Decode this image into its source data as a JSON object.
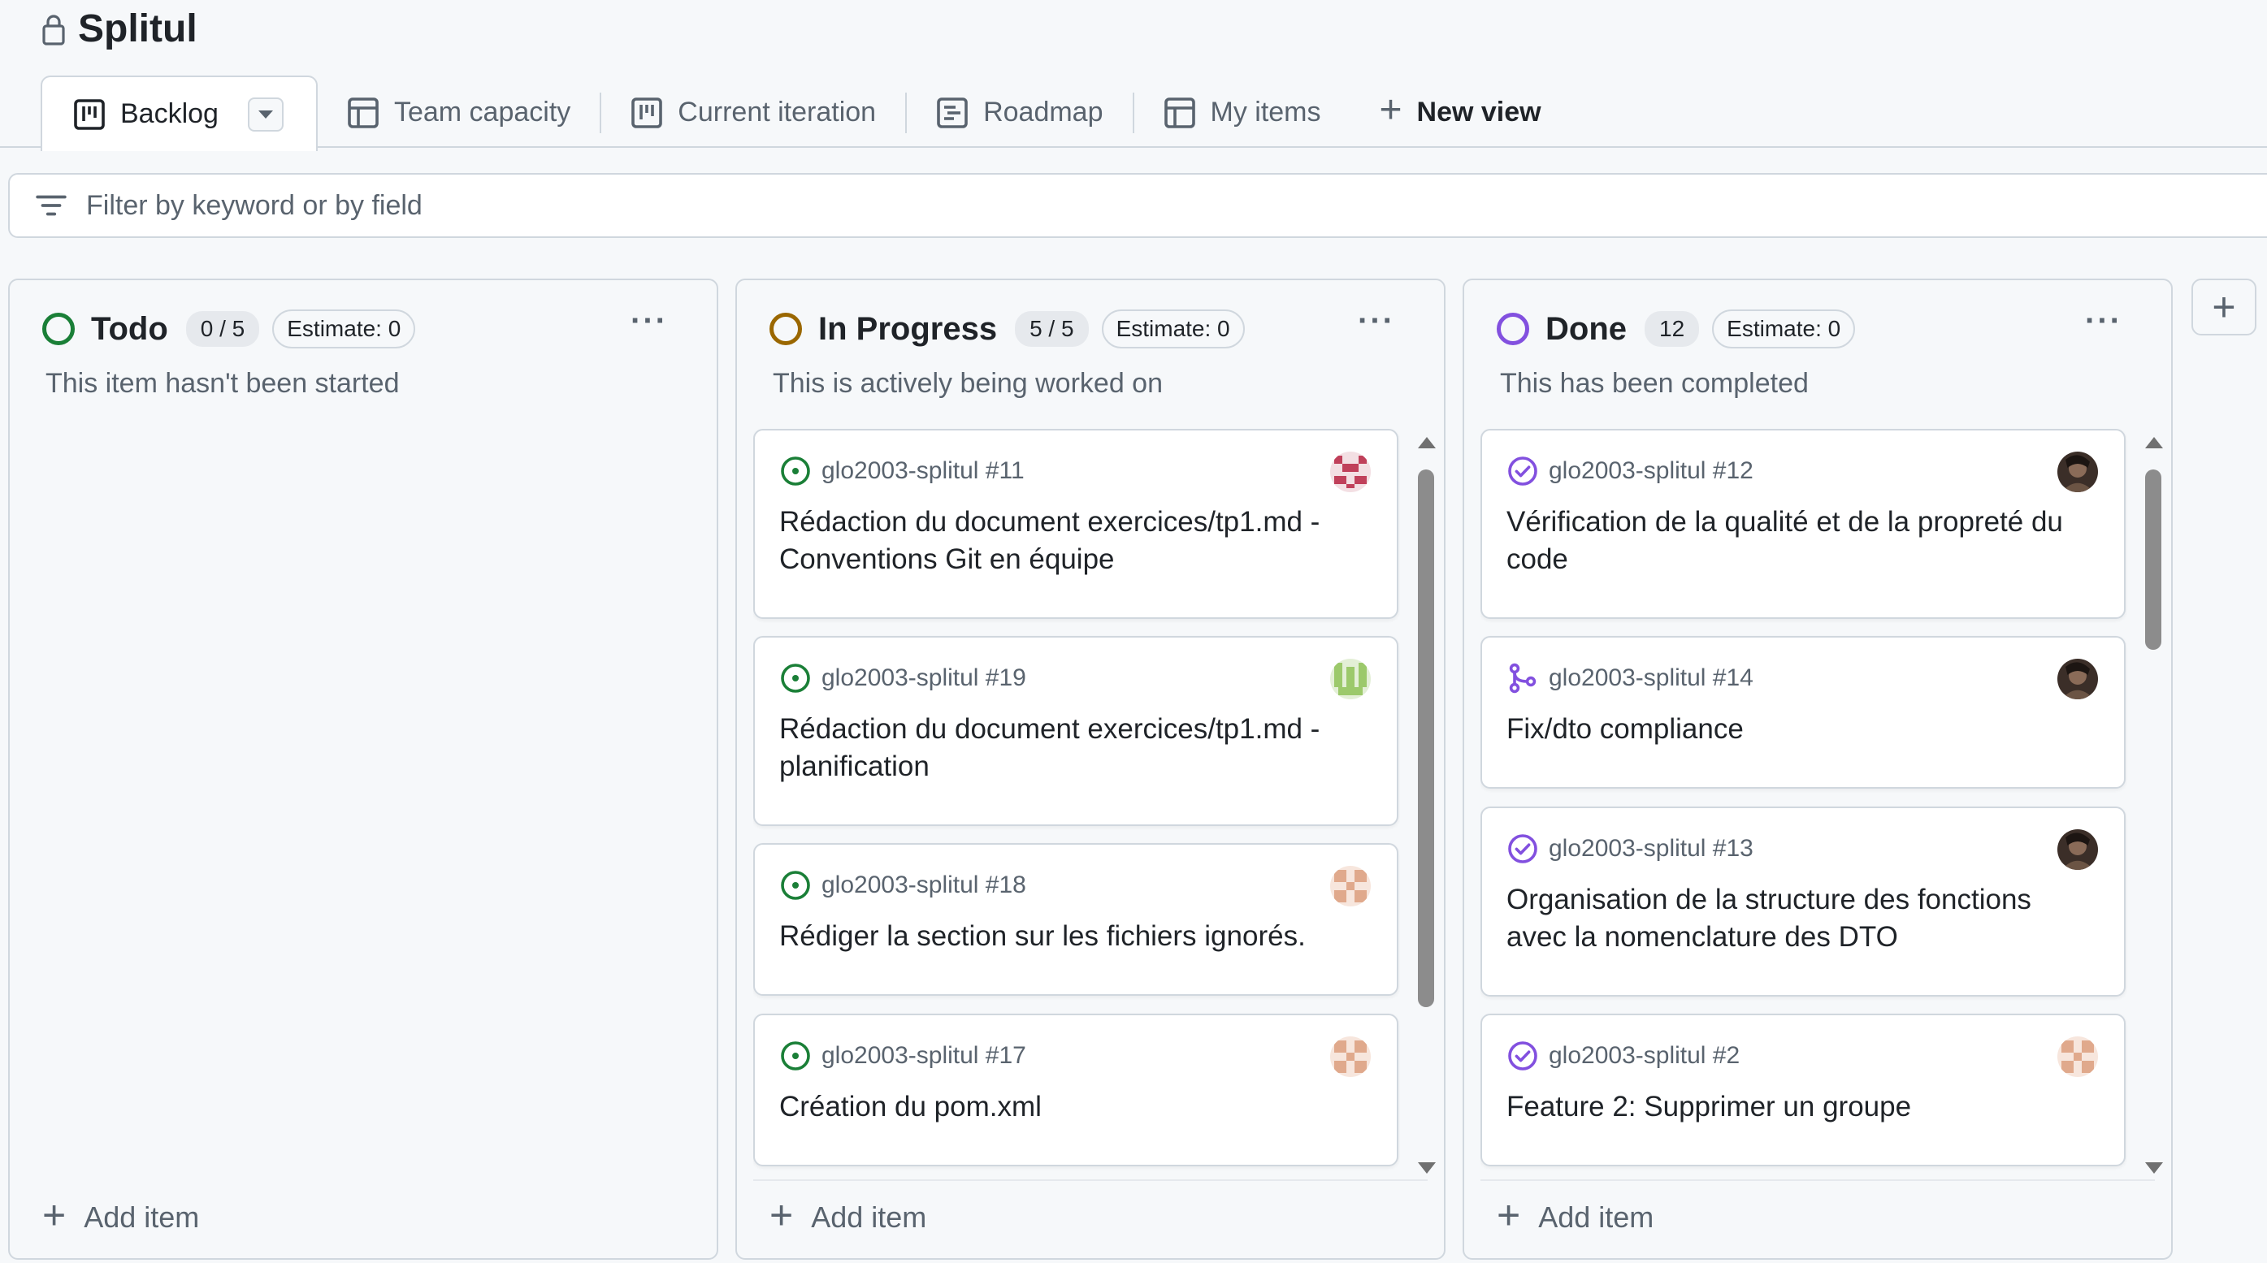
{
  "project": {
    "title": "Splitul"
  },
  "views": [
    {
      "label": "Backlog",
      "icon": "board-icon",
      "active": true
    },
    {
      "label": "Team capacity",
      "icon": "table-icon"
    },
    {
      "label": "Current iteration",
      "icon": "board-icon"
    },
    {
      "label": "Roadmap",
      "icon": "roadmap-icon"
    },
    {
      "label": "My items",
      "icon": "table-icon"
    }
  ],
  "new_view_label": "New view",
  "filter": {
    "placeholder": "Filter by keyword or by field"
  },
  "colors": {
    "todo": "#1a7f37",
    "in_progress": "#9a6700",
    "done": "#8250df",
    "open_issue": "#1a7f37",
    "pr": "#8250df"
  },
  "columns": [
    {
      "name": "Todo",
      "count": "0 / 5",
      "estimate": "Estimate: 0",
      "description": "This item hasn't been started",
      "cards": []
    },
    {
      "name": "In Progress",
      "count": "5 / 5",
      "estimate": "Estimate: 0",
      "description": "This is actively being worked on",
      "cards": [
        {
          "ref": "glo2003-splitul #11",
          "title": "Rédaction du document exercices/tp1.md - Conventions Git en équipe",
          "type": "open-issue",
          "avatar": "identicon-red"
        },
        {
          "ref": "glo2003-splitul #19",
          "title": "Rédaction du document exercices/tp1.md - planification",
          "type": "open-issue",
          "avatar": "identicon-green"
        },
        {
          "ref": "glo2003-splitul #18",
          "title": "Rédiger la section sur les fichiers ignorés.",
          "type": "open-issue",
          "avatar": "identicon-peach"
        },
        {
          "ref": "glo2003-splitul #17",
          "title": "Création du pom.xml",
          "type": "open-issue",
          "avatar": "identicon-peach"
        }
      ]
    },
    {
      "name": "Done",
      "count": "12",
      "estimate": "Estimate: 0",
      "description": "This has been completed",
      "cards": [
        {
          "ref": "glo2003-splitul #12",
          "title": "Vérification de la qualité et de la propreté du code",
          "type": "closed-issue",
          "avatar": "photo"
        },
        {
          "ref": "glo2003-splitul #14",
          "title": "Fix/dto compliance",
          "type": "merged-pr",
          "avatar": "photo"
        },
        {
          "ref": "glo2003-splitul #13",
          "title": "Organisation de la structure des fonctions avec la nomenclature des DTO",
          "type": "closed-issue",
          "avatar": "photo"
        },
        {
          "ref": "glo2003-splitul #2",
          "title": "Feature 2: Supprimer un groupe",
          "type": "closed-issue",
          "avatar": "identicon-peach"
        }
      ]
    }
  ],
  "add_item_label": "Add item"
}
